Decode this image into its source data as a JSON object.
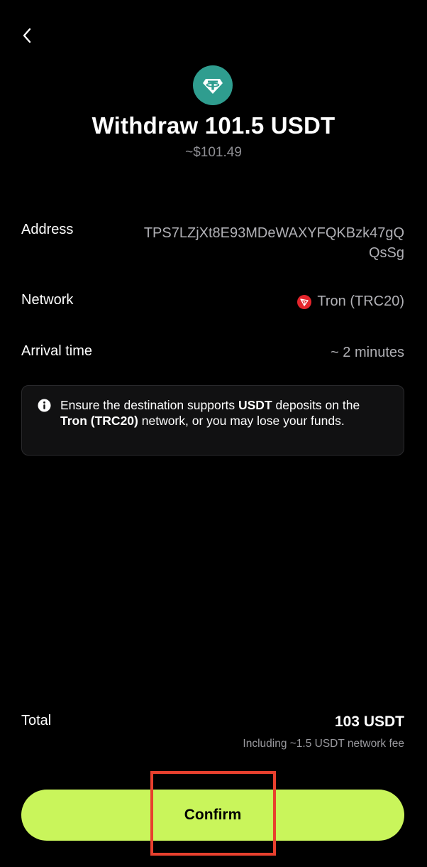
{
  "header": {
    "back_icon": "chevron-left-icon",
    "token_icon": "tether-icon",
    "title": "Withdraw 101.5 USDT",
    "fiat_value": "~$101.49"
  },
  "details": {
    "address": {
      "label": "Address",
      "value": "TPS7LZjXt8E93MDeWAXYFQKBzk47gQQsSg"
    },
    "network": {
      "label": "Network",
      "value": "Tron (TRC20)",
      "icon": "tron-icon"
    },
    "arrival": {
      "label": "Arrival time",
      "value": "~ 2 minutes"
    }
  },
  "notice": {
    "icon": "info-icon",
    "part1": "Ensure the destination supports ",
    "asset": "USDT",
    "part2": " deposits on the ",
    "network": "Tron (TRC20)",
    "part3": " network, or you may lose your funds."
  },
  "total": {
    "label": "Total",
    "value": "103 USDT",
    "fee_note": "Including ~1.5 USDT network fee"
  },
  "confirm": {
    "label": "Confirm"
  },
  "colors": {
    "accent": "#c9f55b",
    "tether": "#2f9d8f",
    "tron": "#e5252c",
    "highlight": "#e8402e"
  }
}
